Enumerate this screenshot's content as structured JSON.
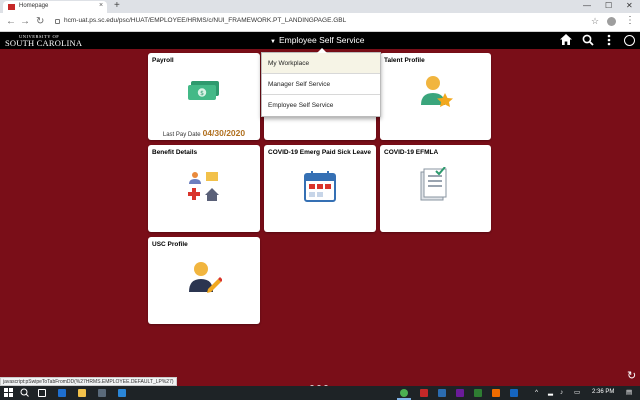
{
  "browser": {
    "tab_title": "Homepage",
    "tab_close": "×",
    "new_tab": "+",
    "minimize": "—",
    "maximize": "☐",
    "close": "✕",
    "back": "←",
    "forward": "→",
    "reload": "↻",
    "url": "hcm-uat.ps.sc.edu/psc/HUAT/EMPLOYEE/HRMS/c/NUI_FRAMEWORK.PT_LANDINGPAGE.GBL",
    "bookmark_star": "☆",
    "menu": "⋮"
  },
  "header": {
    "logo_line1": "UNIVERSITY OF",
    "logo_line2": "SOUTH CAROLINA",
    "title": "Employee Self Service",
    "caret": "▼",
    "home_icon": "home-icon",
    "search_icon": "search-icon",
    "actions_icon": "more-vertical-icon",
    "navbar_icon": "compass-icon"
  },
  "tiles": {
    "payroll": {
      "title": "Payroll",
      "foot_label": "Last Pay Date",
      "foot_value": "04/30/2020"
    },
    "talent": {
      "title": "Talent Profile"
    },
    "benefits": {
      "title": "Benefit Details"
    },
    "covid_sick": {
      "title": "COVID-19 Emerg Paid Sick Leave"
    },
    "covid_efmla": {
      "title": "COVID-19 EFMLA"
    },
    "usc_profile": {
      "title": "USC Profile"
    }
  },
  "dropdown": {
    "items": [
      "My Workplace",
      "Manager Self Service",
      "Employee Self Service"
    ],
    "selected": "My Workplace"
  },
  "status_bar_url": "javascript:pSwipeToTabFromDD(%27HRMS.EMPLOYEE.DEFAULT_LP%27)",
  "taskbar": {
    "clock": "2:36 PM"
  },
  "colors": {
    "background": "#7a0e18",
    "header": "#000000",
    "pay_date": "#b0701f"
  }
}
